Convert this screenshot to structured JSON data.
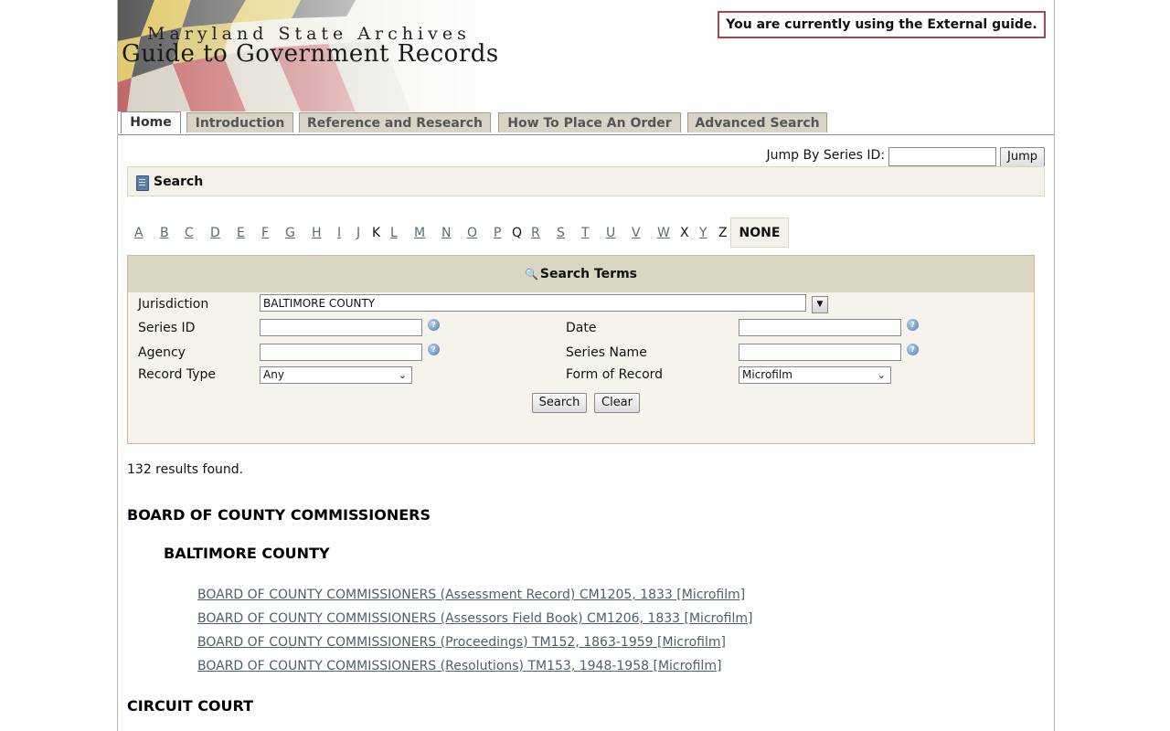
{
  "header": {
    "title_top": "Maryland State Archives",
    "title_main": "Guide to Government Records",
    "guide_notice": "You are currently using the External guide."
  },
  "tabs": [
    {
      "label": "Home",
      "active": true
    },
    {
      "label": "Introduction"
    },
    {
      "label": "Reference and Research"
    },
    {
      "label": "How To Place An Order"
    },
    {
      "label": "Advanced Search"
    }
  ],
  "jump": {
    "label": "Jump By Series ID:",
    "button": "Jump",
    "value": ""
  },
  "search_bar": {
    "title": "Search",
    "icon": "book-icon"
  },
  "alphabet": {
    "letters": [
      "A",
      "B",
      "C",
      "D",
      "E",
      "F",
      "G",
      "H",
      "I",
      "J",
      "K",
      "L",
      "M",
      "N",
      "O",
      "P",
      "Q",
      "R",
      "S",
      "T",
      "U",
      "V",
      "W",
      "X",
      "Y",
      "Z"
    ],
    "non_linked": [
      "K",
      "Q",
      "X",
      "Z"
    ],
    "none_label": "NONE"
  },
  "search_terms": {
    "title": "Search Terms",
    "jurisdiction": {
      "label": "Jurisdiction",
      "value": "BALTIMORE COUNTY"
    },
    "series_id": {
      "label": "Series ID",
      "value": ""
    },
    "date": {
      "label": "Date",
      "value": ""
    },
    "agency": {
      "label": "Agency",
      "value": ""
    },
    "series_name": {
      "label": "Series Name",
      "value": ""
    },
    "record_type": {
      "label": "Record Type",
      "value": "Any"
    },
    "form_of_record": {
      "label": "Form of Record",
      "value": "Microfilm"
    },
    "search_button": "Search",
    "clear_button": "Clear",
    "help_glyph": "?"
  },
  "results": {
    "count_text": "132 results found.",
    "groups": [
      {
        "heading": "BOARD OF COUNTY COMMISSIONERS",
        "subheading": "BALTIMORE COUNTY",
        "links": [
          "BOARD OF COUNTY COMMISSIONERS (Assessment Record) CM1205, 1833 [Microfilm]",
          "BOARD OF COUNTY COMMISSIONERS (Assessors Field Book) CM1206, 1833 [Microfilm]",
          "BOARD OF COUNTY COMMISSIONERS (Proceedings) TM152, 1863-1959 [Microfilm]",
          "BOARD OF COUNTY COMMISSIONERS (Resolutions) TM153, 1948-1958 [Microfilm]"
        ]
      },
      {
        "heading": "CIRCUIT COURT"
      }
    ]
  },
  "colors": {
    "tab_bg": "#d8d3c5",
    "panel_bg": "#f5f3ec",
    "panel_header": "#d9d6c3",
    "notice_border": "#9b4b4b",
    "link": "#4d5f6e"
  }
}
